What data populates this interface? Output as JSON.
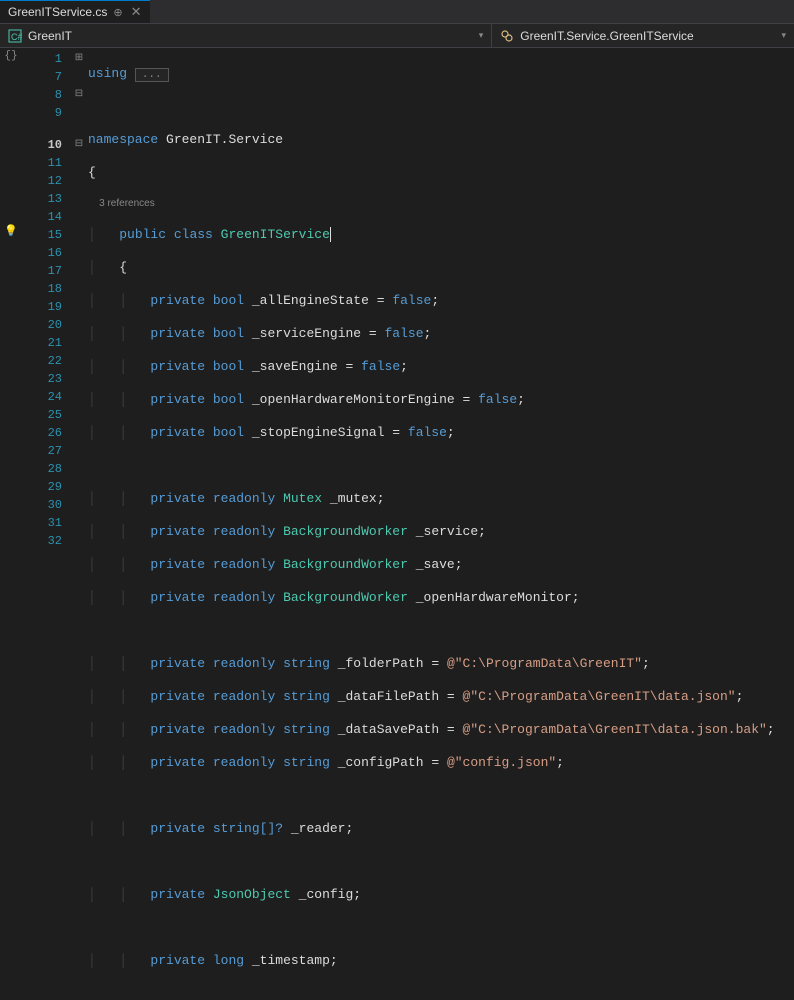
{
  "tab": {
    "filename": "GreenITService.cs",
    "pin_glyph": "⊕",
    "close_glyph": "✕"
  },
  "nav": {
    "left_label": "GreenIT",
    "right_label": "GreenIT.Service.GreenITService",
    "dropdown_glyph": "▾"
  },
  "margin": {
    "brace_glyph": "{}"
  },
  "fold": {
    "plus": "⊞",
    "minus": "⊟"
  },
  "codelens": {
    "references": "3 references"
  },
  "collapsed": {
    "dots": "..."
  },
  "line_numbers": [
    "1",
    "7",
    "8",
    "9",
    "",
    "10",
    "11",
    "12",
    "13",
    "14",
    "15",
    "16",
    "17",
    "18",
    "19",
    "20",
    "21",
    "22",
    "23",
    "24",
    "25",
    "26",
    "27",
    "28",
    "29",
    "30",
    "31",
    "32"
  ],
  "code": {
    "using": "using",
    "namespace": "namespace",
    "ns_name": "GreenIT.Service",
    "public": "public",
    "class": "class",
    "class_name": "GreenITService",
    "private": "private",
    "readonly": "readonly",
    "bool": "bool",
    "string": "string",
    "string_arr_q": "string[]?",
    "long": "long",
    "mutex": "Mutex",
    "bgw": "BackgroundWorker",
    "jsonobj": "JsonObject",
    "false": "false",
    "eq": " = ",
    "semi": ";",
    "at": "@",
    "obrace": "{",
    "cbrace": "}",
    "f_allEngineState": "_allEngineState",
    "f_serviceEngine": "_serviceEngine",
    "f_saveEngine": "_saveEngine",
    "f_openHardwareMonitorEngine": "_openHardwareMonitorEngine",
    "f_stopEngineSignal": "_stopEngineSignal",
    "f_mutex": "_mutex",
    "f_service": "_service",
    "f_save": "_save",
    "f_openHardwareMonitor": "_openHardwareMonitor",
    "f_folderPath": "_folderPath",
    "f_dataFilePath": "_dataFilePath",
    "f_dataSavePath": "_dataSavePath",
    "f_configPath": "_configPath",
    "f_reader": "_reader",
    "f_config": "_config",
    "f_timestamp": "_timestamp",
    "s_folder": "\"C:\\ProgramData\\GreenIT\"",
    "s_datafile": "\"C:\\ProgramData\\GreenIT\\data.json\"",
    "s_datasave": "\"C:\\ProgramData\\GreenIT\\data.json.bak\"",
    "s_config": "\"config.json\""
  }
}
